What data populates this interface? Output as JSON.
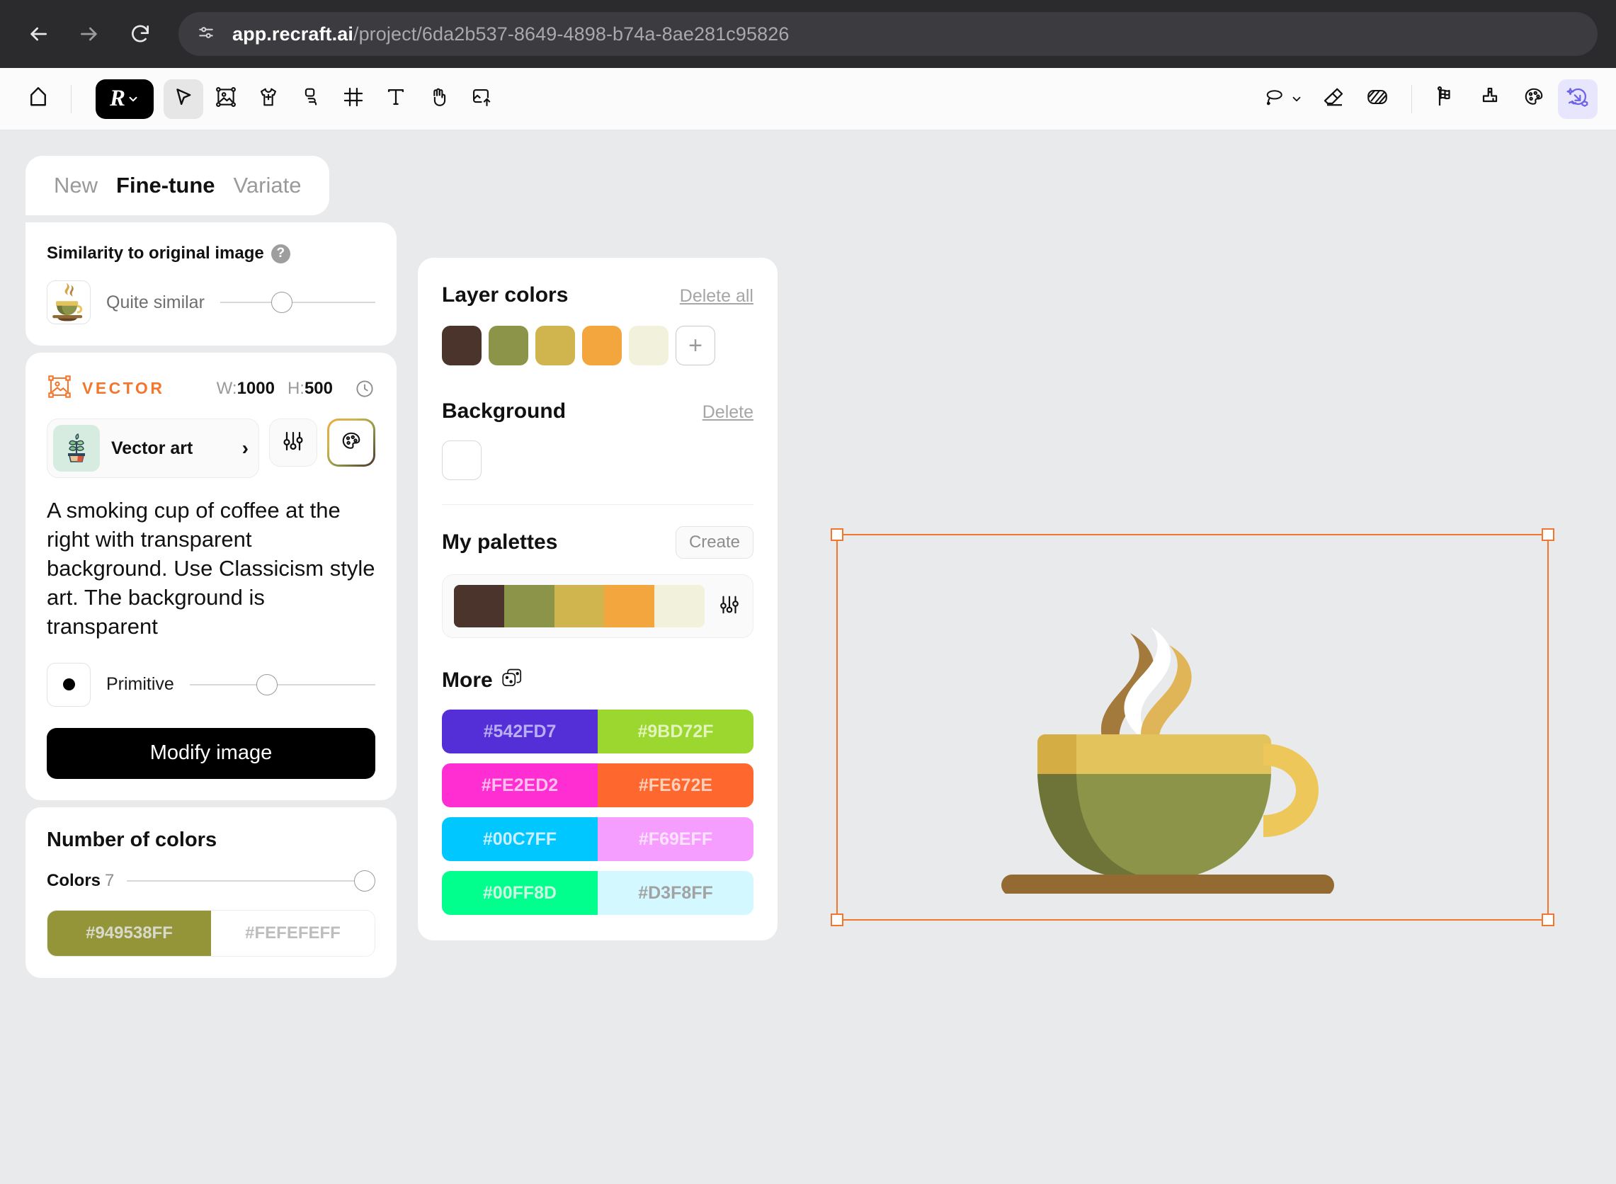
{
  "browser": {
    "back_icon": "arrow-left-icon",
    "forward_icon": "arrow-right-icon",
    "reload_icon": "reload-icon",
    "site_info_icon": "site-settings-icon",
    "url_host": "app.recraft.ai",
    "url_path": "/project/6da2b537-8649-4898-b74a-8ae281c95826"
  },
  "toolbar": {
    "left_items": [
      {
        "name": "home-icon",
        "label": "Home"
      },
      {
        "name": "recraft-logo-button",
        "label": "R"
      },
      {
        "name": "select-tool-icon",
        "label": "Select"
      },
      {
        "name": "image-tool-icon",
        "label": "Image"
      },
      {
        "name": "mockup-tool-icon",
        "label": "Mockup"
      },
      {
        "name": "shape-tool-icon",
        "label": "Shapes"
      },
      {
        "name": "frame-tool-icon",
        "label": "Frame"
      },
      {
        "name": "text-tool-icon",
        "label": "Text"
      },
      {
        "name": "hand-tool-icon",
        "label": "Hand"
      },
      {
        "name": "upload-tool-icon",
        "label": "Upload"
      }
    ],
    "right_items": [
      {
        "name": "lasso-tool-icon",
        "label": "Lasso"
      },
      {
        "name": "eraser-tool-icon",
        "label": "Eraser"
      },
      {
        "name": "texture-tool-icon",
        "label": "Texture"
      },
      {
        "name": "style-flag-icon",
        "label": "Styles"
      },
      {
        "name": "mockup-stack-icon",
        "label": "Mockups"
      },
      {
        "name": "palette-icon",
        "label": "Colors"
      },
      {
        "name": "generate-icon",
        "label": "Generate"
      }
    ]
  },
  "left_panel": {
    "tabs": [
      {
        "label": "New",
        "active": false
      },
      {
        "label": "Fine-tune",
        "active": true
      },
      {
        "label": "Variate",
        "active": false
      }
    ],
    "similarity": {
      "title": "Similarity to original image",
      "help_icon": "question-mark-icon",
      "thumbnail_icon": "coffee-cup-thumbnail",
      "value_label": "Quite similar",
      "slider_percent": 35
    },
    "vector": {
      "badge_icon": "vector-frame-icon",
      "badge_label": "VECTOR",
      "width_key": "W:",
      "width_value": "1000",
      "height_key": "H:",
      "height_value": "500",
      "history_icon": "clock-icon",
      "style_name": "Vector art",
      "style_thumb_icon": "plant-pot-icon",
      "chevron_icon": "chevron-right-icon",
      "adjust_icon": "sliders-icon",
      "palette_icon": "palette-icon",
      "prompt": "A smoking cup of coffee at the right with transparent background. Use Classicism style art. The background is transparent",
      "primitive_label": "Primitive",
      "primitive_slider_percent": 38,
      "modify_button": "Modify image"
    },
    "number_of_colors": {
      "title": "Number of colors",
      "colors_label": "Colors",
      "colors_value": "7",
      "slider_percent": 100,
      "hex_active": "#949538FF",
      "hex_active_bg": "#949538",
      "hex_inactive": "#FEFEFEFF",
      "hex_inactive_bg": "#FFFFFF"
    }
  },
  "mid_panel": {
    "layer_colors": {
      "title": "Layer colors",
      "delete_all_label": "Delete all",
      "swatches": [
        "#4B342C",
        "#8C9449",
        "#D0B44D",
        "#F2A63D",
        "#F2F2DC"
      ],
      "add_icon": "plus-icon"
    },
    "background": {
      "title": "Background",
      "delete_label": "Delete",
      "swatch": "#FFFFFF"
    },
    "my_palettes": {
      "title": "My palettes",
      "create_label": "Create",
      "palette_colors": [
        "#4B342C",
        "#8C9449",
        "#D0B44D",
        "#F2A63D",
        "#F2F2DC"
      ],
      "adjust_icon": "sliders-icon"
    },
    "more": {
      "title": "More",
      "dice_icon": "dice-icon",
      "pairs": [
        {
          "left_hex": "#542FD7",
          "right_hex": "#9BD72F"
        },
        {
          "left_hex": "#FE2ED2",
          "right_hex": "#FE672E"
        },
        {
          "left_hex": "#00C7FF",
          "right_hex": "#F69EFF"
        },
        {
          "left_hex": "#00FF8D",
          "right_hex": "#D3F8FF"
        }
      ]
    }
  },
  "canvas": {
    "selection_color": "#F2762E",
    "artwork_name": "coffee-cup-illustration",
    "artwork_colors": {
      "saucer_top": "#946A33",
      "saucer_bottom": "#66421F",
      "cup_body": "#8C9449",
      "cup_body_shadow": "#6E7437",
      "cup_rim": "#E3C35C",
      "cup_rim_shadow": "#D4AE45",
      "handle": "#EDC75A",
      "steam_brown": "#A3793C",
      "steam_white": "#FFFFFF",
      "steam_gold": "#E0B558"
    }
  }
}
